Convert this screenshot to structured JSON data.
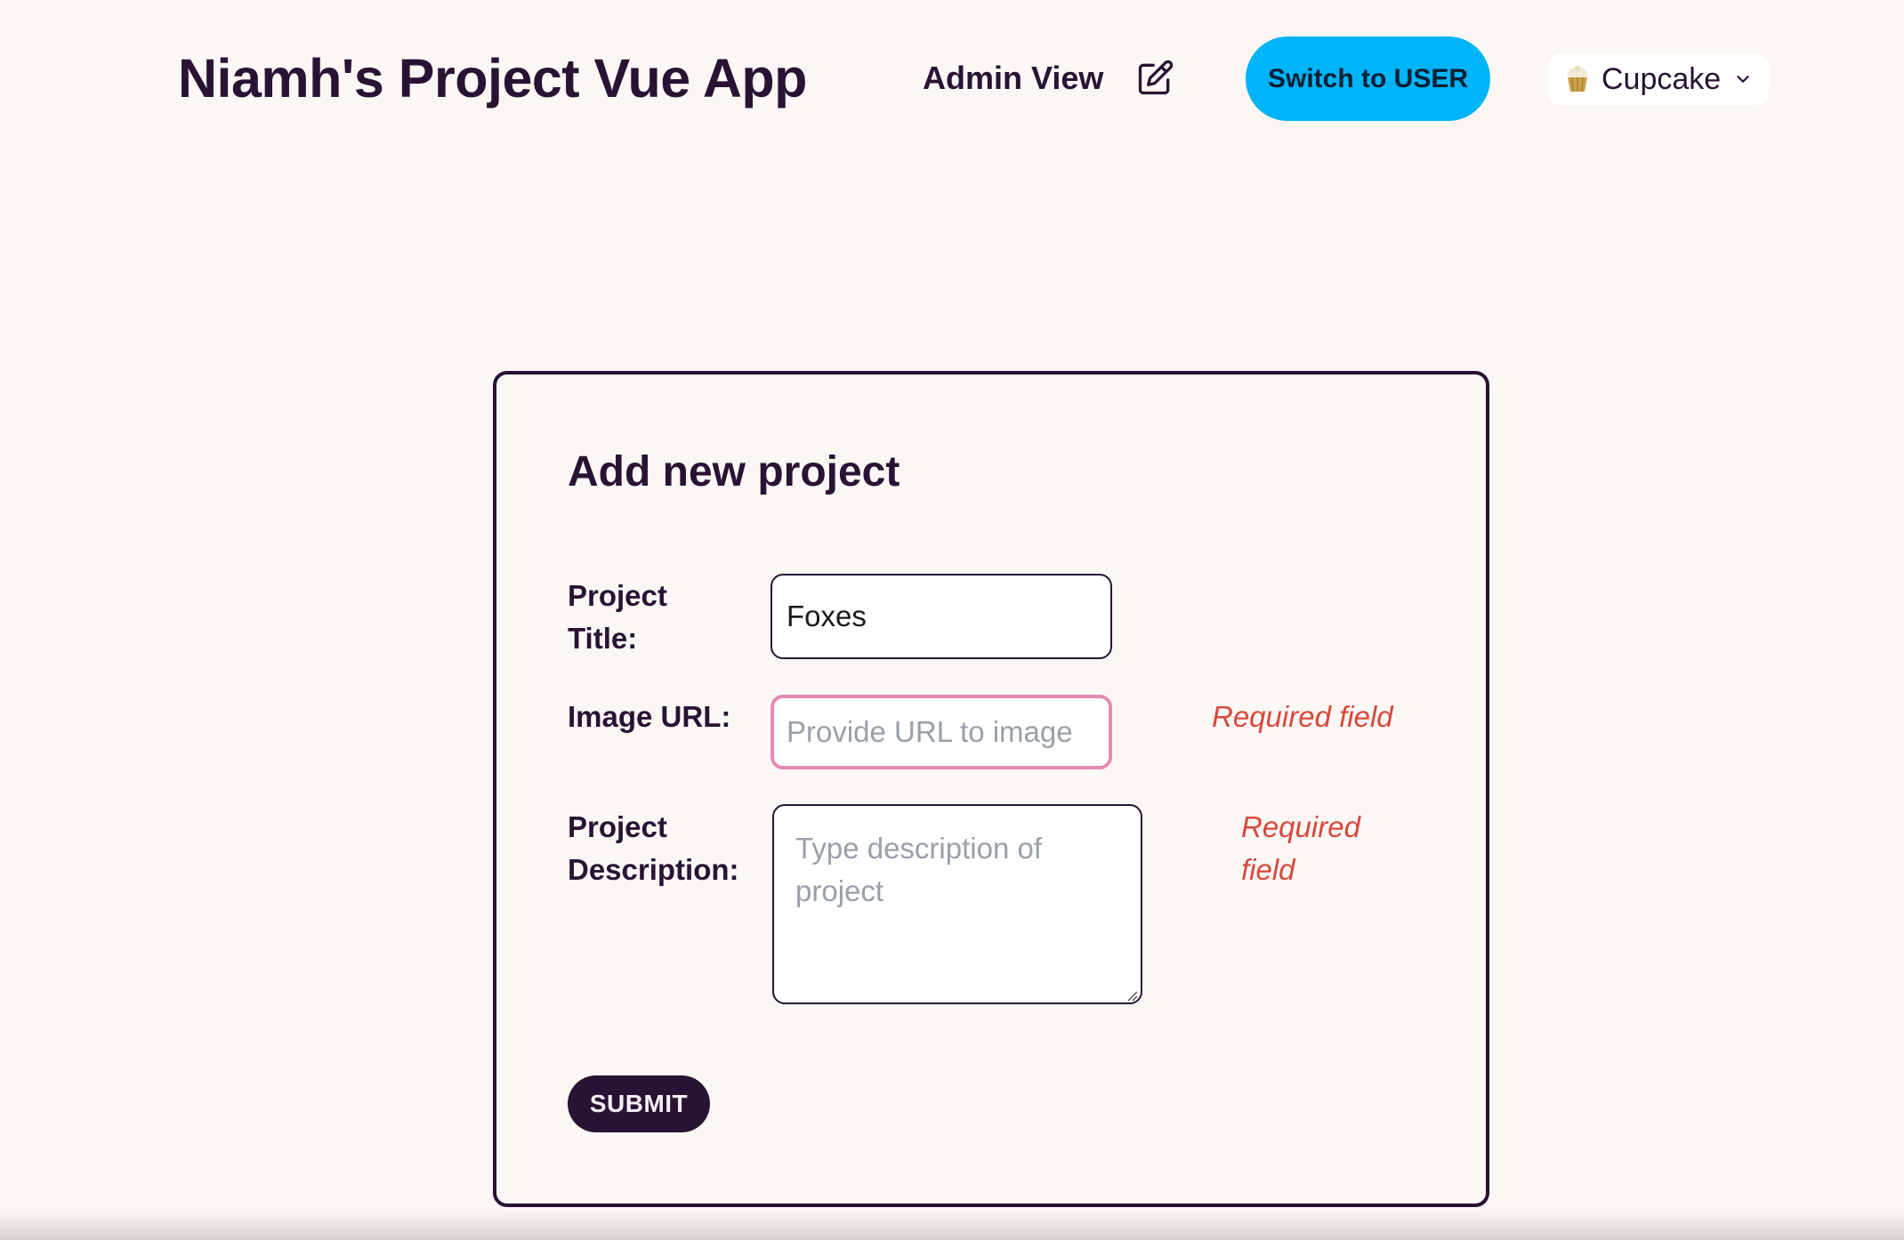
{
  "header": {
    "app_title": "Niamh's Project Vue App",
    "view_label": "Admin View",
    "edit_icon": "edit-icon",
    "switch_button_label": "Switch to USER",
    "theme": {
      "icon": "cupcake-icon",
      "selected": "Cupcake"
    }
  },
  "form": {
    "heading": "Add new project",
    "title_label_line1": "Project",
    "title_label_line2": "Title:",
    "title_value": "Foxes",
    "image_label": "Image URL:",
    "image_placeholder": "Provide URL to image",
    "image_value": "",
    "image_error": "Required field",
    "description_label_line1": "Project",
    "description_label_line2": "Description:",
    "description_placeholder": "Type description of project",
    "description_value": "",
    "description_error_line1": "Required",
    "description_error_line2": "field",
    "submit_label": "SUBMIT"
  },
  "colors": {
    "background": "#faf7f5",
    "text": "#291334",
    "accent_button": "#00b4f8",
    "focus_border": "#e48ab7",
    "error": "#d9483b"
  }
}
